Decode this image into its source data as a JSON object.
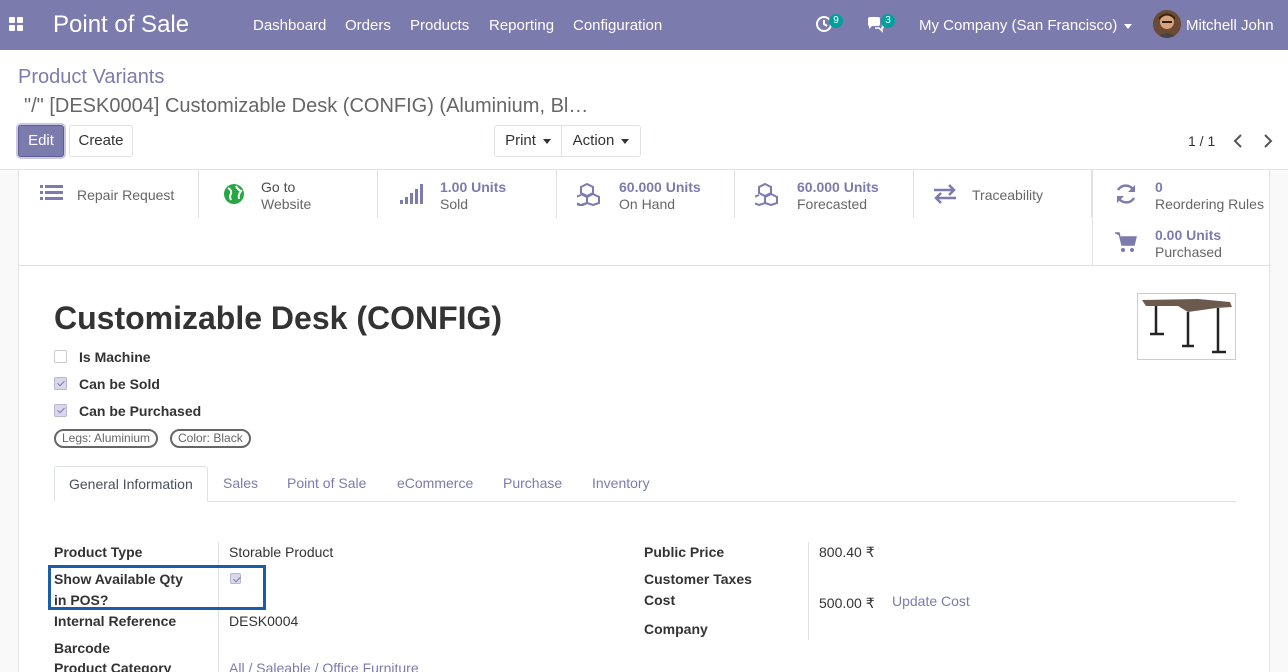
{
  "navbar": {
    "app_title": "Point of Sale",
    "menus": [
      "Dashboard",
      "Orders",
      "Products",
      "Reporting",
      "Configuration"
    ],
    "activity_count": "9",
    "message_count": "3",
    "company": "My Company (San Francisco)",
    "user": "Mitchell John",
    "brand_color": "#7c7bad"
  },
  "control_panel": {
    "breadcrumb_parent": "Product Variants",
    "breadcrumb_current": "\"/\" [DESK0004] Customizable Desk (CONFIG) (Aluminium, Bl…",
    "edit_label": "Edit",
    "create_label": "Create",
    "print_label": "Print",
    "action_label": "Action",
    "pager": "1 / 1"
  },
  "smart_buttons": {
    "repair": "Repair Request",
    "website_line1": "Go to",
    "website_line2": "Website",
    "sold_value": "1.00 Units",
    "sold_label": "Sold",
    "onhand_value": "60.000 Units",
    "onhand_label": "On Hand",
    "forecast_value": "60.000 Units",
    "forecast_label": "Forecasted",
    "traceability": "Traceability",
    "reorder_value": "0",
    "reorder_label": "Reordering Rules",
    "purchased_value": "0.00 Units",
    "purchased_label": "Purchased"
  },
  "product": {
    "name": "Customizable Desk (CONFIG)",
    "is_machine_label": "Is Machine",
    "is_machine": false,
    "can_be_sold_label": "Can be Sold",
    "can_be_sold": true,
    "can_be_purchased_label": "Can be Purchased",
    "can_be_purchased": true,
    "attributes": [
      "Legs: Aluminium",
      "Color: Black"
    ]
  },
  "tabs": [
    "General Information",
    "Sales",
    "Point of Sale",
    "eCommerce",
    "Purchase",
    "Inventory"
  ],
  "general_info": {
    "product_type_label": "Product Type",
    "product_type": "Storable Product",
    "show_qty_label_1": "Show Available Qty",
    "show_qty_label_2": "in POS?",
    "show_qty": true,
    "internal_ref_label": "Internal Reference",
    "internal_ref": "DESK0004",
    "barcode_label": "Barcode",
    "category_label": "Product Category",
    "category": "All / Saleable / Office Furniture",
    "public_price_label": "Public Price",
    "public_price": "800.40 ₹",
    "customer_taxes_label": "Customer Taxes",
    "cost_label": "Cost",
    "cost": "500.00 ₹",
    "update_cost": "Update Cost",
    "company_label": "Company"
  }
}
